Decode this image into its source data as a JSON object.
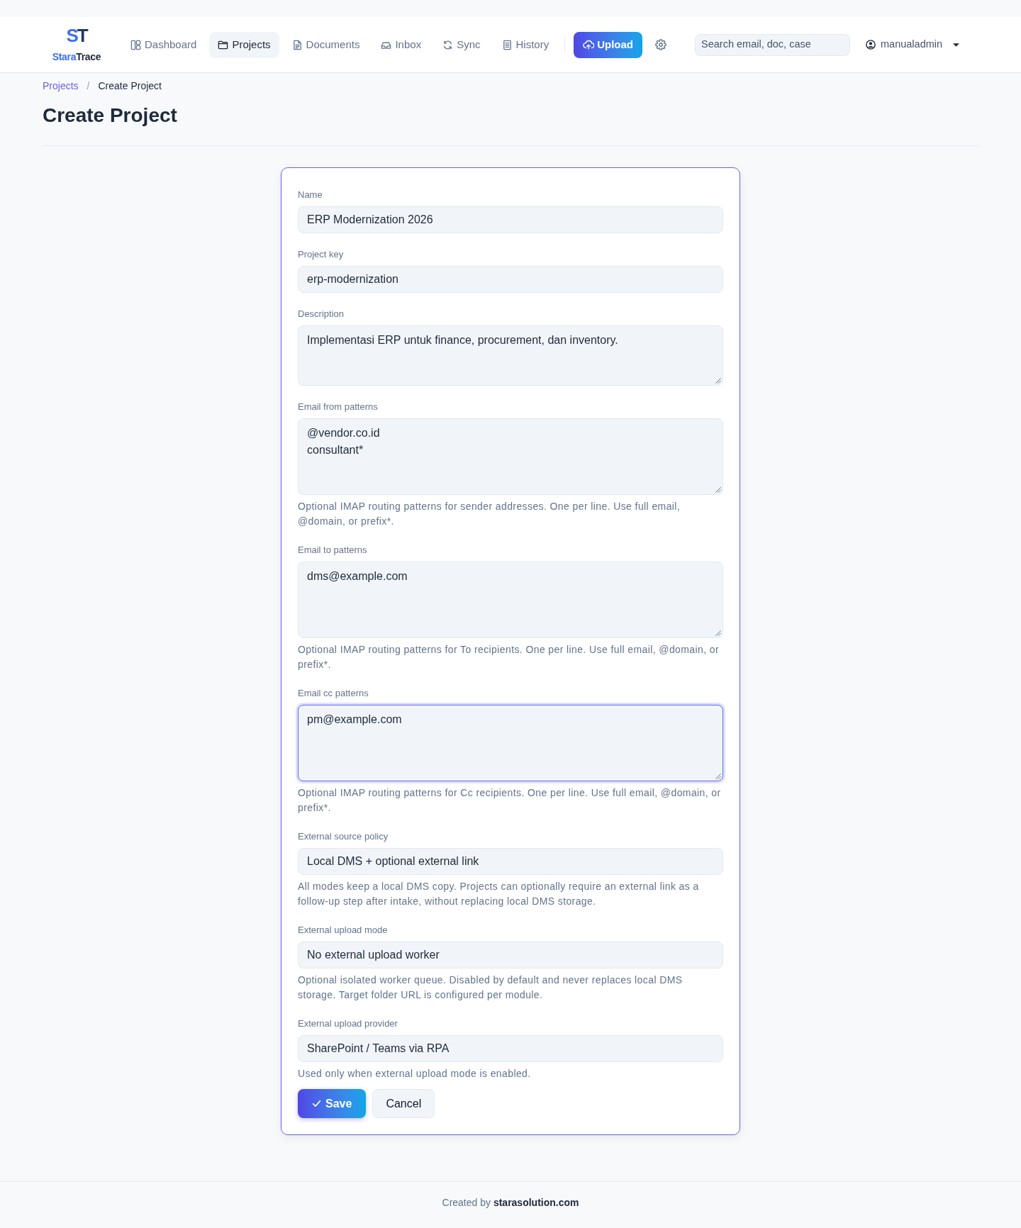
{
  "header": {
    "logo": {
      "mark": {
        "accent_part": "S",
        "plain_part": "T"
      },
      "brand": {
        "accent_part": "Stara",
        "plain_part": "Trace"
      }
    },
    "nav": {
      "items": [
        {
          "label": "Dashboard",
          "selected": false
        },
        {
          "label": "Projects",
          "selected": true
        },
        {
          "label": "Documents",
          "selected": false
        },
        {
          "label": "Inbox",
          "selected": false
        },
        {
          "label": "Sync",
          "selected": false
        },
        {
          "label": "History",
          "selected": false
        }
      ]
    },
    "upload_button": {
      "label": "Upload"
    },
    "search": {
      "placeholder": "Search email, doc, case"
    },
    "user_menu": {
      "username": "manualadmin"
    }
  },
  "breadcrumb": {
    "items": [
      {
        "label": "Projects",
        "kind": "link"
      },
      {
        "label": "Create Project",
        "kind": "current"
      }
    ],
    "separator": "/"
  },
  "page_title": "Create Project",
  "form": {
    "fields": [
      {
        "label": "Name",
        "kind": "input",
        "value": "ERP Modernization 2026",
        "focused": false
      },
      {
        "label": "Project key",
        "kind": "input",
        "value": "erp-modernization",
        "focused": false
      },
      {
        "label": "Description",
        "kind": "textarea",
        "value": "Implementasi ERP untuk finance, procurement, dan inventory.",
        "focused": false
      },
      {
        "label": "Email from patterns",
        "kind": "patternlist",
        "value": "@vendor.co.id\nconsultant*",
        "help": "Optional IMAP routing patterns for sender addresses. One per line. Use full email, @domain, or prefix*.",
        "focused": false
      },
      {
        "label": "Email to patterns",
        "kind": "patternlist",
        "value": "dms@example.com",
        "help": "Optional IMAP routing patterns for To recipients. One per line. Use full email, @domain, or prefix*.",
        "focused": false
      },
      {
        "label": "Email cc patterns",
        "kind": "patternlist",
        "value": "pm@example.com",
        "help": "Optional IMAP routing patterns for Cc recipients. One per line. Use full email, @domain, or prefix*.",
        "focused": true
      },
      {
        "label": "External source policy",
        "kind": "select",
        "value": "Local DMS + optional external link",
        "help": "All modes keep a local DMS copy. Projects can optionally require an external link as a follow-up step after intake, without replacing local DMS storage.",
        "focused": false
      },
      {
        "label": "External upload mode",
        "kind": "select",
        "value": "No external upload worker",
        "help": "Optional isolated worker queue. Disabled by default and never replaces local DMS storage. Target folder URL is configured per module.",
        "focused": false
      },
      {
        "label": "External upload provider",
        "kind": "select",
        "value": "SharePoint / Teams via RPA",
        "help": "Used only when external upload mode is enabled.",
        "focused": false
      }
    ],
    "buttons": [
      {
        "label": "Save",
        "kind": "submit"
      },
      {
        "label": "Cancel",
        "kind": "cancel"
      }
    ]
  },
  "footer": {
    "credit": "Created by **starasolution.com**"
  }
}
